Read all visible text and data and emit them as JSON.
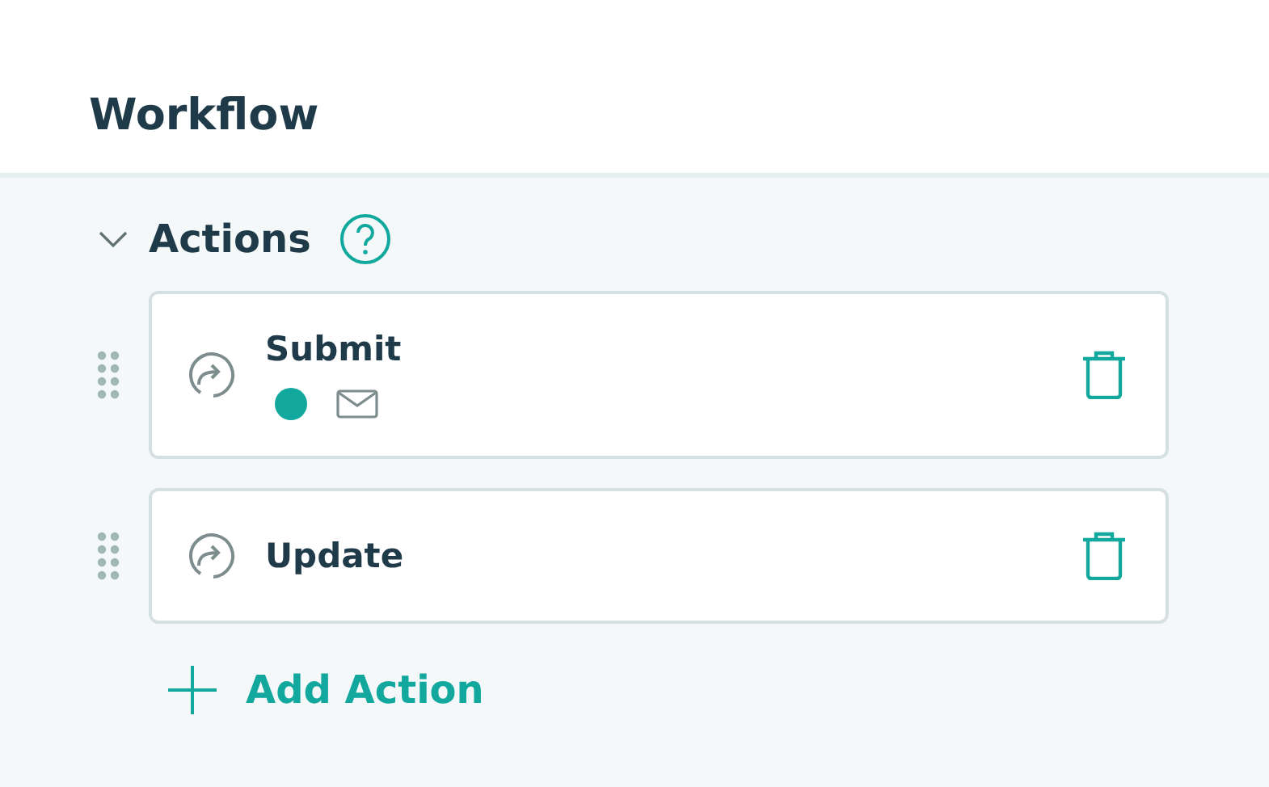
{
  "title": "Workflow",
  "section": {
    "label": "Actions",
    "expanded": true
  },
  "actions": [
    {
      "title": "Submit",
      "indicators": [
        {
          "kind": "dot",
          "color": "#13a89e"
        },
        {
          "kind": "mail"
        }
      ]
    },
    {
      "title": "Update"
    }
  ],
  "add_button": {
    "label": "Add Action"
  }
}
